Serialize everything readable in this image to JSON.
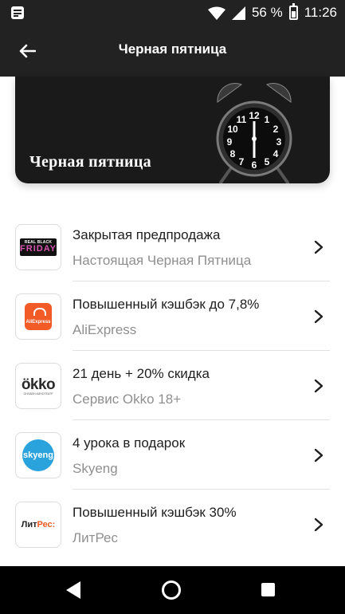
{
  "status_bar": {
    "battery_percent": "56 %",
    "time": "11:26",
    "icons": [
      "notification-icon",
      "wifi-icon",
      "signal-icon",
      "battery-icon"
    ]
  },
  "app_bar": {
    "title": "Черная пятница",
    "back_icon": "arrow-left-icon"
  },
  "banner": {
    "title": "Черная пятница",
    "clock_numerals": [
      "12",
      "1",
      "2",
      "3",
      "4",
      "5",
      "6",
      "7",
      "8",
      "9",
      "10",
      "11"
    ],
    "colors": {
      "background": "#1a1a1a"
    }
  },
  "offers": [
    {
      "title": "Закрытая предпродажа",
      "subtitle": "Настоящая Черная Пятница",
      "logo": {
        "line1": "REAL BLACK",
        "line2": "FRIDAY"
      }
    },
    {
      "title": "Повышенный кэшбэк до 7,8%",
      "subtitle": "AliExpress",
      "logo": {
        "text": "AliExpress"
      }
    },
    {
      "title": "21 день + 20% скидка",
      "subtitle": "Сервис Okko 18+",
      "logo": {
        "text": "ökko",
        "subtext": "ОНЛАЙН-КИНОТЕАТР"
      }
    },
    {
      "title": "4 урока в подарок",
      "subtitle": "Skyeng",
      "logo": {
        "text": "skyeng"
      }
    },
    {
      "title": "Повышенный кэшбэк 30%",
      "subtitle": "ЛитРес",
      "logo": {
        "part1": "Лит",
        "part2": "Рес:"
      }
    }
  ],
  "colors": {
    "header": "#222222",
    "title_text": "#1e1e1e",
    "subtitle_text": "#8f8f8f",
    "divider": "#e2e2e2",
    "aliexpress": "#f25a26",
    "skyeng": "#2aa3dc",
    "friday_pink": "#d455b0"
  }
}
